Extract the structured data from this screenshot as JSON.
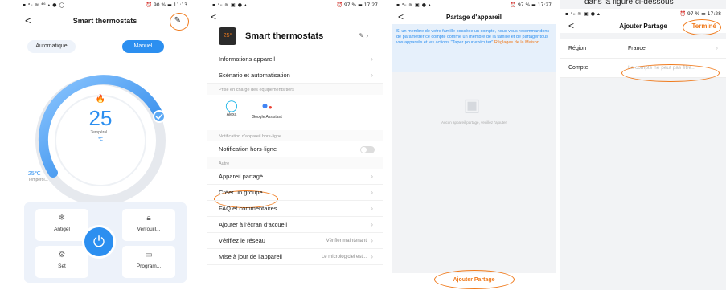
{
  "caption_fragment": "dans la figure ci-dessous",
  "colors": {
    "accent_blue": "#2c8ff0",
    "highlight_orange": "#f07a1c"
  },
  "screen1": {
    "status_left": "▪ ᵃₗₗ ≋ ⁴⁶ ▴ ● ◯",
    "status_right": "⏰ 90 % ▬ 11:13",
    "title": "Smart thermostats",
    "back_icon": "chevron-left",
    "edit_icon": "pencil",
    "mode_auto": "Automatique",
    "mode_manual": "Manuel",
    "setpoint": "25",
    "setpoint_label": "Tempéral...",
    "setpoint_unit": "℃",
    "current_temp": "25℃",
    "current_label": "Tempérol...",
    "buttons": {
      "antigel": "Antigel",
      "verrou": "Verrouill...",
      "set": "Set",
      "program": "Program..."
    }
  },
  "screen2": {
    "status_left": "▪ ᵃₗₗ ≋ ▣ ● ▴",
    "status_right": "⏰ 97 % ▬ 17:27",
    "device_name": "Smart thermostats",
    "device_icon_text": "25°",
    "rows_top": [
      "Informations appareil",
      "Scénario et automatisation"
    ],
    "section_third": "Prise en charge des équipements tiers",
    "alexa": "Alexa",
    "google": "Google Assistant",
    "section_notif": "Notification d'appareil hors-ligne",
    "notif_row": "Notification hors-ligne",
    "section_other": "Autre",
    "rows_other": [
      "Appareil partagé",
      "Créer un groupe",
      "FAQ et commentaires",
      "Ajouter à l'écran d'accueil",
      "Vérifiez le réseau",
      "Mise à jour de l'appareil"
    ],
    "network_value": "Vérifier maintenant",
    "update_value": "Le micrologiciel est..."
  },
  "screen3": {
    "status_left": "▪ ᵃₗₗ ≋ ▣ ● ▴",
    "status_right": "⏰ 97 % ▬ 17:27",
    "title": "Partage d'appareil",
    "info": "Si un membre de votre famille possède un compte, nous vous recommandons de paramétrer ce compte comme un membre de la famille et de partager tous vos appareils et les actions \"Taper pour exécuter\"",
    "info_link": "Réglages de la Maison",
    "empty_text": "Aucun appareil partagé, veuillez l'ajouter",
    "add_button": "Ajouter Partage"
  },
  "screen4": {
    "status_left": "▪ ᵃₗₗ ≋ ▣ ● ▴",
    "status_right": "⏰ 97 % ▬ 17:28",
    "title": "Ajouter Partage",
    "done": "Terminé",
    "region_label": "Région",
    "region_value": "France",
    "account_label": "Compte",
    "account_placeholder": "Le compte ne peut pas être..."
  }
}
